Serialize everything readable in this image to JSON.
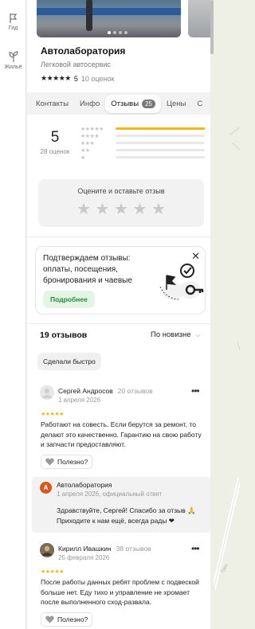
{
  "rail": {
    "items": [
      {
        "label": "Гид",
        "icon": "flag-icon"
      },
      {
        "label": "Жильё",
        "icon": "plant-icon"
      }
    ]
  },
  "org": {
    "name": "Автолаборатория",
    "category": "Легковой автосервис",
    "stars": "★★★★★",
    "rating": "5",
    "ratings_count": "10 оценок"
  },
  "tabs": [
    {
      "label": "Контакты"
    },
    {
      "label": "Инфо"
    },
    {
      "label": "Отзывы",
      "count": "25",
      "active": true
    },
    {
      "label": "Цены"
    },
    {
      "label": "С"
    }
  ],
  "summary": {
    "score": "5",
    "count_label": "28 оценок",
    "distribution": [
      {
        "stars": "★★★★★",
        "fraction": 1.0
      },
      {
        "stars": "★★★★",
        "fraction": 0.0
      },
      {
        "stars": "★★★",
        "fraction": 0.0
      },
      {
        "stars": "★★",
        "fraction": 0.0
      },
      {
        "stars": "★",
        "fraction": 0.0
      }
    ]
  },
  "rate_prompt": {
    "title": "Оцените и оставьте отзыв",
    "stars": "★ ★ ★ ★ ★"
  },
  "promo": {
    "text": "Подтверждаем отзывы: оплаты, посещения, бронирования и чаевые",
    "button": "Подробнее",
    "close": "✕"
  },
  "reviews_header": {
    "count": "19 отзывов",
    "sort": "По новизне"
  },
  "filter_chip": "Сделали быстро",
  "reviews": [
    {
      "author": "Сергей Андросов",
      "level": "20 отзывов",
      "date": "1 апреля 2026",
      "stars": "★★★★★",
      "text": "Работают на совесть. Если берутся за ремонт, то делают это качественно. Гарантию на свою работу и запчасти предоставляют.",
      "useful": "Полезно?"
    },
    {
      "author": "Кирилл Ивашкин",
      "level": "38 отзывов",
      "date": "25 февраля 2026",
      "stars": "★★★★★",
      "text": "После работы данных ребят проблем с подвеской больше нет. Еду тихо и управление не хромает после выполненного сход-развала.",
      "useful": "Полезно?"
    }
  ],
  "owner_reply": {
    "avatar_letter": "А",
    "author": "Автолаборатория",
    "meta": "1 апреля 2026, официальный ответ",
    "text": "Здравствуйте, Сергей! Спасибо за отзыв 🙏 Приходите к нам ещё, всегда рады ❤"
  },
  "colors": {
    "accent_yellow": "#f3b61a",
    "promo_green": "#2a8a3a",
    "reply_avatar": "#d9581f"
  }
}
